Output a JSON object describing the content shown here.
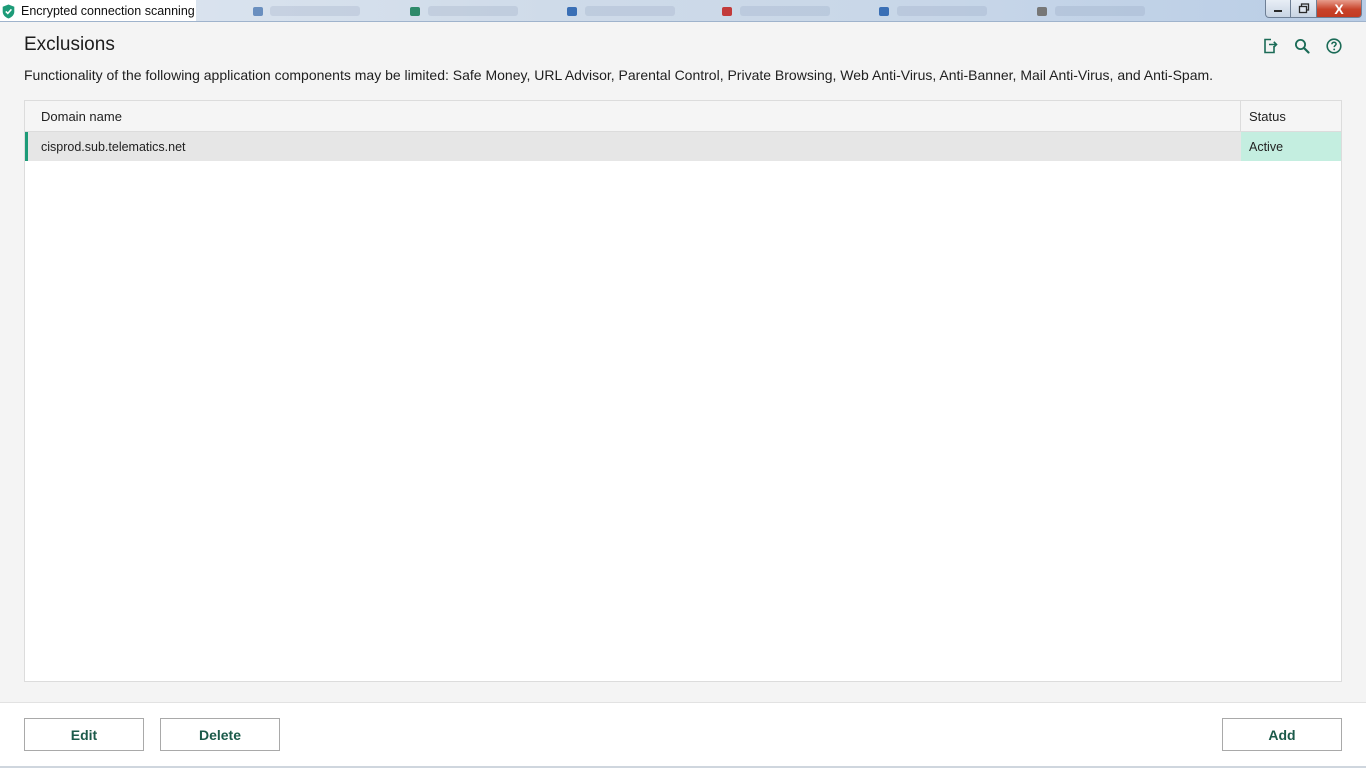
{
  "window": {
    "title": "Encrypted connection scanning",
    "close_glyph": "X"
  },
  "header": {
    "title": "Exclusions",
    "icons": [
      "export-icon",
      "search-icon",
      "help-icon"
    ]
  },
  "description": "Functionality of the following application components may be limited: Safe Money, URL Advisor, Parental Control, Private Browsing, Web Anti-Virus, Anti-Banner, Mail Anti-Virus, and Anti-Spam.",
  "table": {
    "columns": [
      "Domain name",
      "Status"
    ],
    "rows": [
      {
        "domain": "cisprod.sub.telematics.net",
        "status": "Active"
      }
    ]
  },
  "footer": {
    "edit_label": "Edit",
    "delete_label": "Delete",
    "add_label": "Add"
  },
  "colors": {
    "accent": "#1d9b78",
    "status_active_bg": "#c4eee0",
    "button_text": "#1b5a4a"
  }
}
